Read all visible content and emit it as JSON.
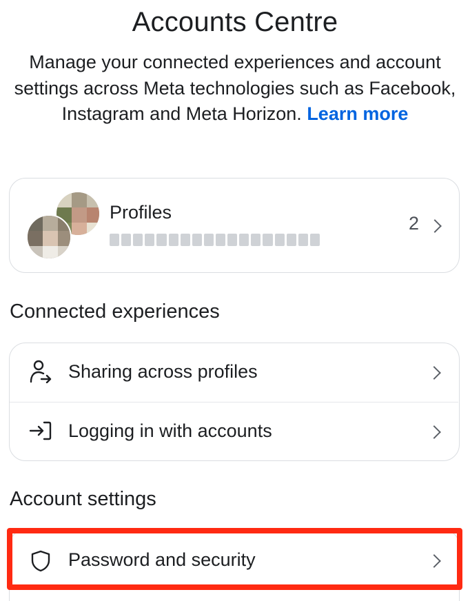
{
  "header": {
    "title": "Accounts Centre",
    "intro_text": "Manage your connected experiences and account settings across Meta technologies such as Facebook, Instagram and Meta Horizon.",
    "learn_more_label": "Learn more"
  },
  "profiles": {
    "label": "Profiles",
    "count": "2"
  },
  "connected_experiences": {
    "heading": "Connected experiences",
    "items": [
      {
        "label": "Sharing across profiles",
        "icon": "person-share-icon"
      },
      {
        "label": "Logging in with accounts",
        "icon": "login-arrow-icon"
      }
    ]
  },
  "account_settings": {
    "heading": "Account settings",
    "items": [
      {
        "label": "Password and security",
        "icon": "shield-icon"
      }
    ]
  },
  "colors": {
    "link": "#0064e0",
    "highlight": "#ff2a12",
    "card_border": "#dadde1"
  }
}
